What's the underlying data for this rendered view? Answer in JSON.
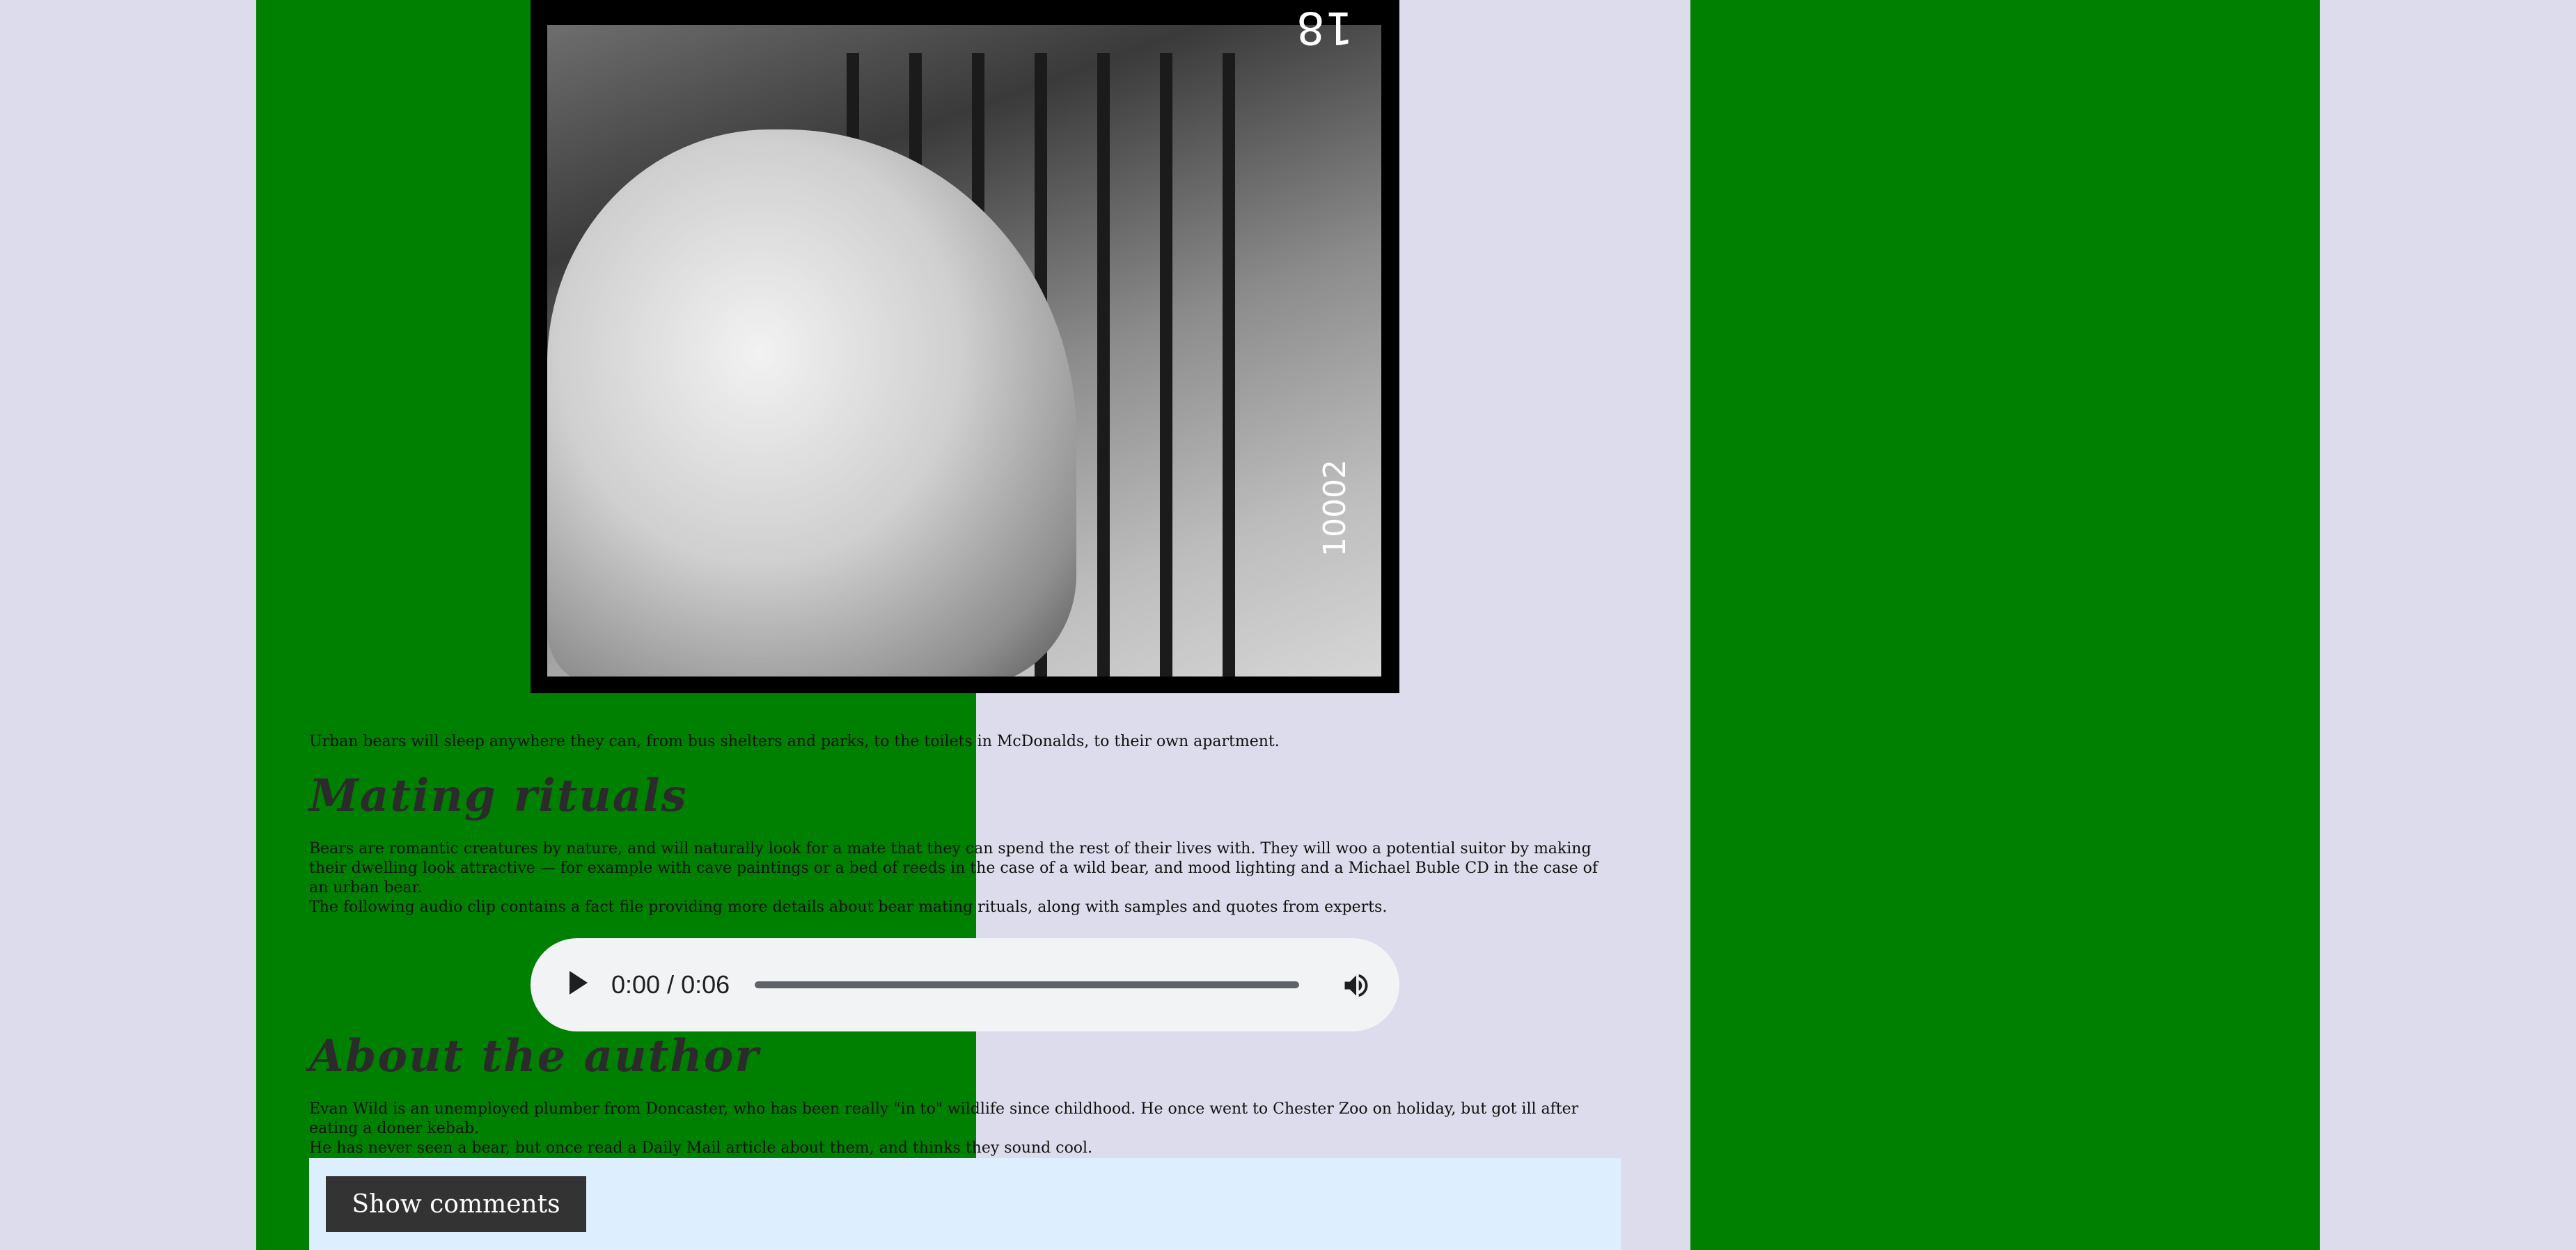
{
  "photo": {
    "frame_number_top": "18",
    "frame_number_side": "10002"
  },
  "paragraphs": {
    "urban_sleep": "Urban bears will sleep anywhere they can, from bus shelters and parks, to the toilets in McDonalds, to their own apartment.",
    "mating_1": "Bears are romantic creatures by nature, and will naturally look for a mate that they can spend the rest of their lives with. They will woo a potential suitor by making their dwelling look attractive — for example with cave paintings or a bed of reeds in the case of a wild bear, and mood lighting and a Michael Buble CD in the case of an urban bear.",
    "mating_2": "The following audio clip contains a fact file providing more details about bear mating rituals, along with samples and quotes from experts.",
    "author_1": "Evan Wild is an unemployed plumber from Doncaster, who has been really \"in to\" wildlife since childhood. He once went to Chester Zoo on holiday, but got ill after eating a doner kebab.",
    "author_2": "He has never seen a bear, but once read a Daily Mail article about them, and thinks they sound cool."
  },
  "headings": {
    "mating": "Mating rituals",
    "author": "About the author"
  },
  "audio": {
    "time": "0:00 / 0:06",
    "progress_fraction": 0
  },
  "comments": {
    "button_label": "Show comments"
  },
  "colors": {
    "page_background": "#dcdcec",
    "column_background": "#008000",
    "comments_background": "#ddeeff"
  }
}
